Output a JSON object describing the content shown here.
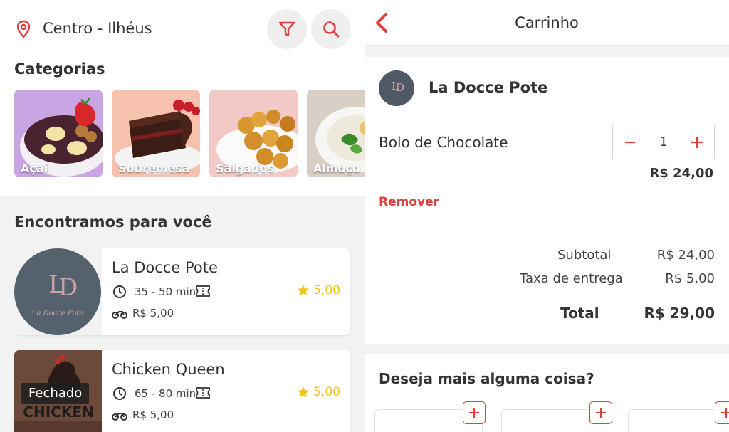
{
  "left": {
    "location": {
      "icon": "map-pin-icon",
      "label": "Centro - Ilhéus"
    },
    "filter_icon": "filter-icon",
    "search_icon": "search-icon",
    "categories_title": "Categorias",
    "categories": [
      {
        "label": "Açaí"
      },
      {
        "label": "Sobremesa"
      },
      {
        "label": "Salgados"
      },
      {
        "label": "Almoço"
      }
    ],
    "found_title": "Encontramos para você",
    "restaurants": [
      {
        "name": "La Docce Pote",
        "time": "35 - 50 min",
        "fee": "R$ 5,00",
        "rating": "5,00",
        "closed": "",
        "logo_text": "La Docce Pote"
      },
      {
        "name": "Chicken Queen",
        "time": "65 - 80 min",
        "fee": "R$ 5,00",
        "rating": "5,00",
        "closed": "Fechado",
        "logo_text": "CHICKEN"
      }
    ]
  },
  "right": {
    "title": "Carrinho",
    "store_name": "La Docce Pote",
    "item": {
      "name": "Bolo de Chocolate",
      "qty": "1",
      "price": "R$ 24,00"
    },
    "remove_label": "Remover",
    "summary": {
      "subtotal_label": "Subtotal",
      "subtotal_value": "R$ 24,00",
      "fee_label": "Taxa de entrega",
      "fee_value": "R$ 5,00",
      "total_label": "Total",
      "total_value": "R$ 29,00"
    },
    "more_title": "Deseja mais alguma coisa?"
  },
  "colors": {
    "accent": "#e0403d",
    "star": "#f2c21c",
    "background": "#f2f2f3"
  }
}
